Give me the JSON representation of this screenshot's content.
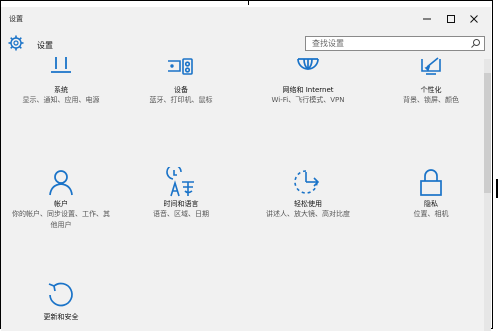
{
  "window": {
    "title": "设置"
  },
  "header": {
    "title": "设置",
    "search_placeholder": "查找设置"
  },
  "tiles": [
    {
      "name": "系统",
      "desc": "显示、通知、应用、电源",
      "icon": "system-icon"
    },
    {
      "name": "设备",
      "desc": "蓝牙、打印机、鼠标",
      "icon": "devices-icon"
    },
    {
      "name": "网络和 Internet",
      "desc": "Wi-Fi、飞行模式、VPN",
      "icon": "network-icon"
    },
    {
      "name": "个性化",
      "desc": "背景、锁屏、颜色",
      "icon": "personalization-icon"
    },
    {
      "name": "帐户",
      "desc": "你的帐户、同步设置、工作、其他用户",
      "icon": "accounts-icon"
    },
    {
      "name": "时间和语言",
      "desc": "语音、区域、日期",
      "icon": "time-language-icon"
    },
    {
      "name": "轻松使用",
      "desc": "讲述人、放大镜、高对比度",
      "icon": "ease-of-access-icon"
    },
    {
      "name": "隐私",
      "desc": "位置、相机",
      "icon": "privacy-icon"
    },
    {
      "name": "更新和安全",
      "desc": "",
      "icon": "update-security-icon"
    }
  ],
  "colors": {
    "accent": "#1a73c8",
    "window_bg": "#f1f1f1"
  }
}
